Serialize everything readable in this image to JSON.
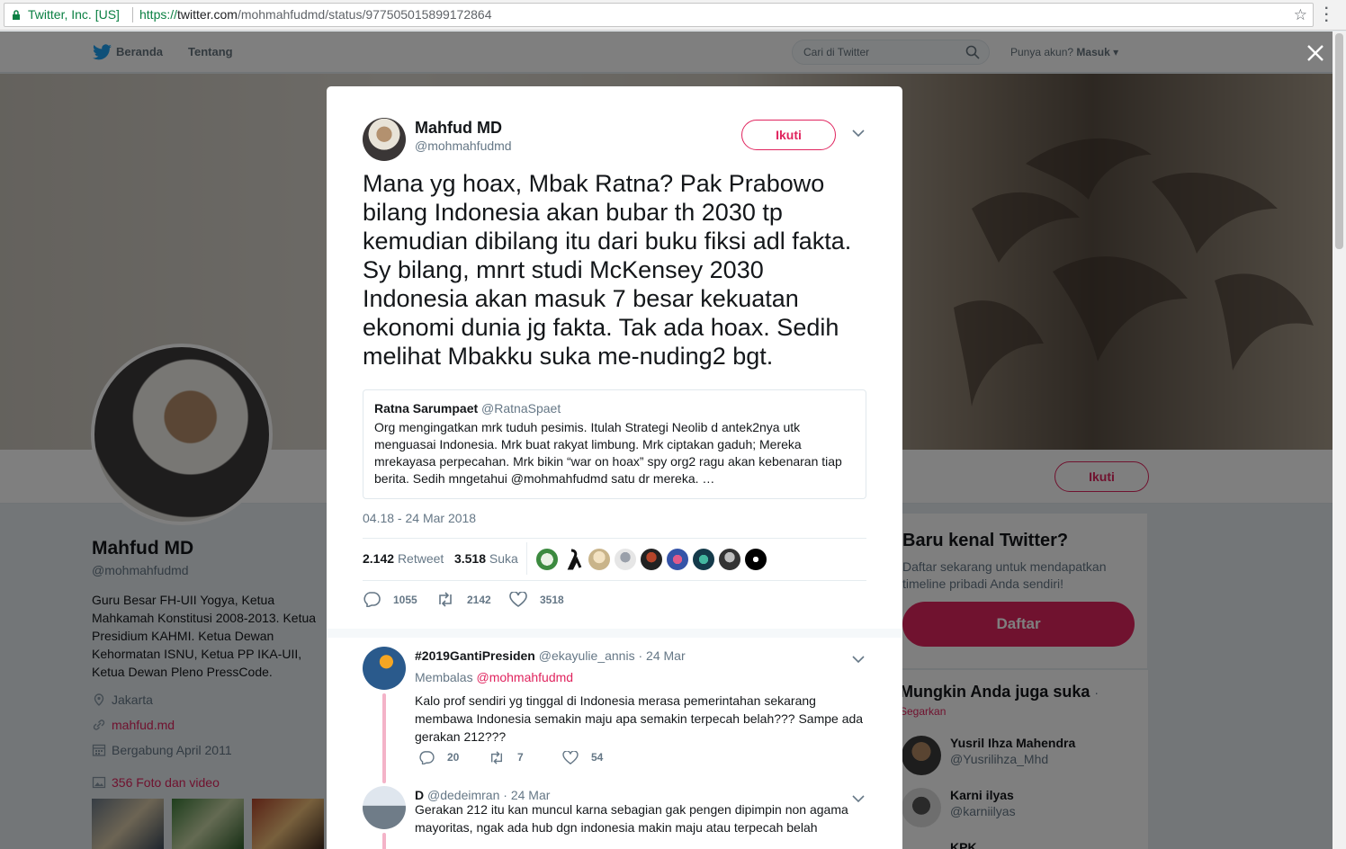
{
  "browser": {
    "secure_label": "Twitter, Inc. [US]",
    "url_scheme": "https://",
    "url_host": "twitter.com",
    "url_path": "/mohmahfudmd/status/977505015899172864"
  },
  "nav": {
    "home": "Beranda",
    "about": "Tentang",
    "search_placeholder": "Cari di Twitter",
    "have_account": "Punya akun?",
    "login": "Masuk"
  },
  "profile": {
    "name": "Mahfud MD",
    "handle": "@mohmahfudmd",
    "bio": "Guru Besar FH-UII Yogya, Ketua Mahkamah Konstitusi 2008-2013. Ketua Presidium KAHMI. Ketua Dewan Kehormatan ISNU, Ketua PP IKA-UII, Ketua Dewan Pleno PressCode.",
    "location": "Jakarta",
    "website": "mahfud.md",
    "joined": "Bergabung April 2011",
    "photos": "356 Foto dan video",
    "follow": "Ikuti"
  },
  "sidebar": {
    "new_title": "Baru kenal Twitter?",
    "new_desc": "Daftar sekarang untuk mendapatkan timeline pribadi Anda sendiri!",
    "signup": "Daftar",
    "wtf_title": "Mungkin Anda juga suka",
    "wtf_dot": "·",
    "wtf_refresh": "Segarkan",
    "suggestions": [
      {
        "name": "Yusril Ihza Mahendra",
        "handle": "@Yusrilihza_Mhd"
      },
      {
        "name": "Karni ilyas",
        "handle": "@karniilyas"
      },
      {
        "name": "KPK",
        "handle": ""
      }
    ]
  },
  "tweet": {
    "name": "Mahfud MD",
    "handle": "@mohmahfudmd",
    "follow": "Ikuti",
    "text": "Mana yg hoax, Mbak Ratna? Pak Prabowo bilang Indonesia akan bubar th 2030 tp kemudian dibilang itu dari buku fiksi adl fakta. Sy bilang, mnrt studi McKensey 2030 Indonesia akan masuk 7 besar kekuatan ekonomi dunia jg fakta. Tak ada hoax. Sedih melihat Mbakku suka me-nuding2 bgt.",
    "quote": {
      "name": "Ratna Sarumpaet",
      "handle": "@RatnaSpaet",
      "text": "Org mengingatkan mrk tuduh pesimis. Itulah Strategi Neolib d antek2nya utk menguasai Indonesia. Mrk buat rakyat limbung. Mrk ciptakan gaduh; Mereka mrekayasa perpecahan. Mrk bikin “war on hoax” spy org2 ragu akan kebenaran tiap berita. Sedih mngetahui @mohmahfudmd satu dr mereka. …"
    },
    "time": "04.18 - 24 Mar 2018",
    "retweet_count": "2.142",
    "retweet_label": "Retweet",
    "like_count": "3.518",
    "like_label": "Suka",
    "reply_n": "1055",
    "retweet_n": "2142",
    "like_n": "3518"
  },
  "replies": [
    {
      "name": "#2019GantiPresiden",
      "handle": "@ekayulie_annis",
      "time": "· 24 Mar",
      "replying_label": "Membalas",
      "replying_to": "@mohmahfudmd",
      "text": "Kalo prof sendiri yg tinggal di Indonesia merasa pemerintahan sekarang membawa Indonesia semakin maju apa semakin terpecah belah??? Sampe ada gerakan 212???",
      "reply_n": "20",
      "retweet_n": "7",
      "like_n": "54"
    },
    {
      "name": "D",
      "handle": "@dedeimran",
      "time": "· 24 Mar",
      "text": "Gerakan 212 itu kan muncul karna sebagian gak pengen dipimpin non agama mayoritas, ngak ada hub dgn indonesia makin maju atau terpecah belah"
    }
  ],
  "colors": {
    "accent": "#e0245e",
    "twitter_blue": "#1da1f2",
    "muted": "#657786"
  }
}
